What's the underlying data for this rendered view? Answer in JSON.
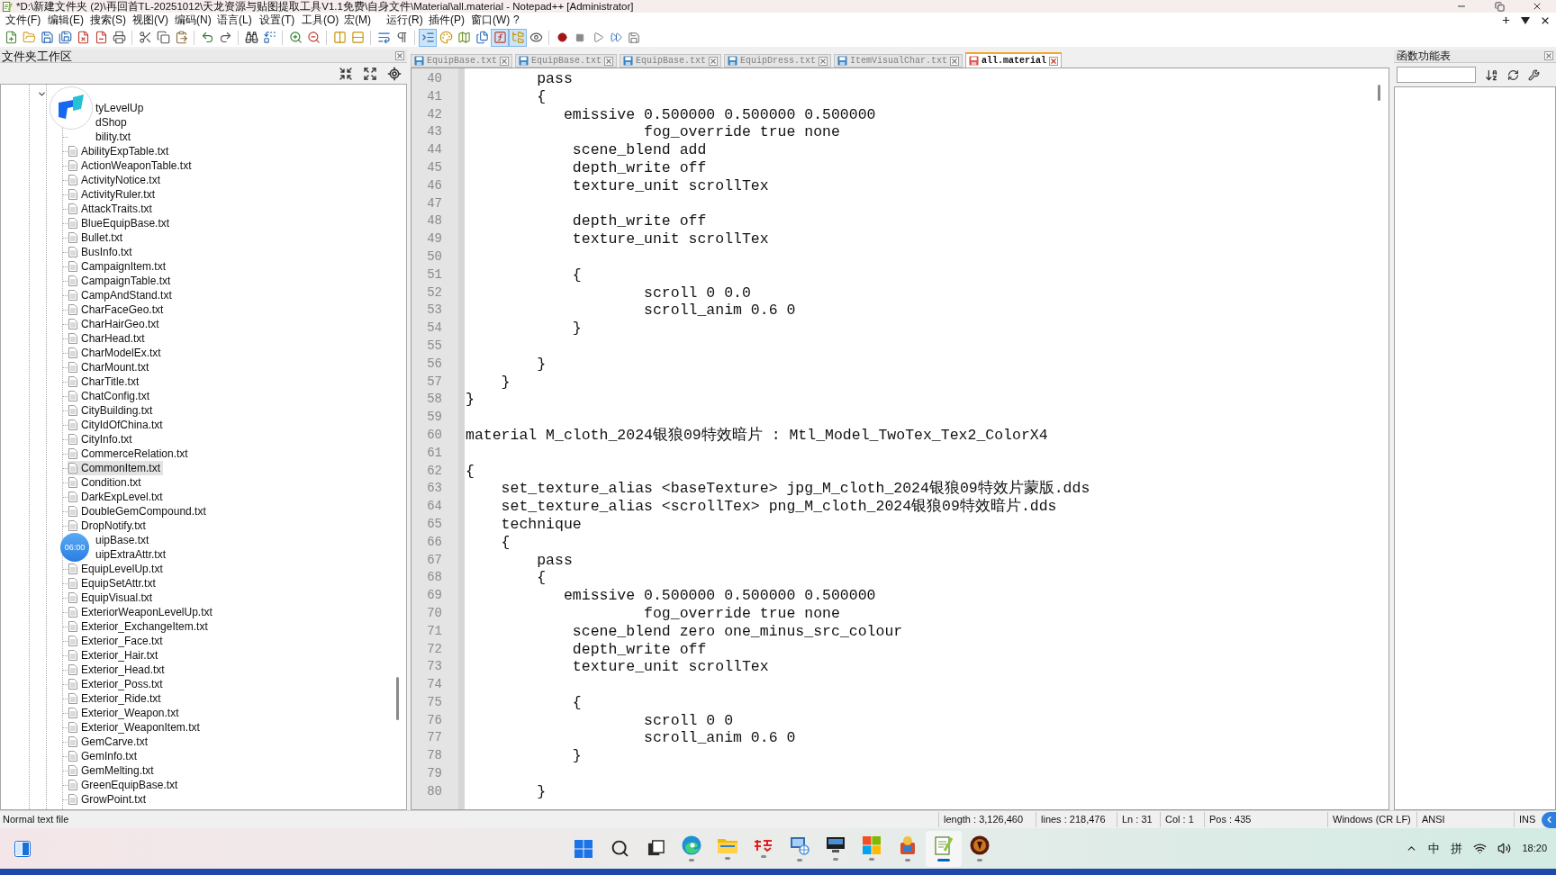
{
  "window": {
    "title": "*D:\\新建文件夹 (2)\\再回首TL-20251012\\天龙资源与贴图提取工具V1.1免费\\自身文件\\Material\\all.material - Notepad++ [Administrator]"
  },
  "menu": [
    "文件(F)",
    "编辑(E)",
    "搜索(S)",
    "视图(V)",
    "编码(N)",
    "语言(L)",
    "设置(T)",
    "工具(O)",
    "宏(M)",
    "运行(R)",
    "插件(P)",
    "窗口(W)",
    "?"
  ],
  "toolbar": [
    {
      "pressed": false
    },
    {
      "pressed": false
    },
    {
      "pressed": false
    },
    {
      "pressed": false
    },
    {
      "pressed": false
    },
    {
      "pressed": false
    },
    {
      "pressed": false
    },
    {
      "pressed": false
    },
    {
      "pressed": false
    },
    {
      "pressed": false
    },
    {
      "pressed": false
    },
    {
      "pressed": false
    },
    {
      "pressed": false
    },
    {
      "pressed": false
    },
    {
      "pressed": false
    },
    {
      "pressed": false
    },
    {
      "pressed": false
    },
    {
      "pressed": false
    },
    {
      "pressed": false
    },
    {
      "pressed": false
    },
    {
      "pressed": true
    },
    {
      "pressed": false
    },
    {
      "pressed": false
    },
    {
      "pressed": false
    },
    {
      "pressed": true
    },
    {
      "pressed": true
    },
    {
      "pressed": false
    },
    {
      "pressed": false
    },
    {
      "pressed": false
    },
    {
      "pressed": false
    },
    {
      "pressed": false
    },
    {
      "pressed": false
    }
  ],
  "folder_panel": {
    "title": "文件夹工作区",
    "tree": {
      "expanded": true,
      "children": [
        {
          "name": "tyLevelUp",
          "kind": "partial",
          "selected": false
        },
        {
          "name": "dShop",
          "kind": "partial",
          "selected": false
        },
        {
          "name": "bility.txt",
          "kind": "partial",
          "selected": false
        },
        {
          "name": "AbilityExpTable.txt",
          "kind": "file",
          "selected": false
        },
        {
          "name": "ActionWeaponTable.txt",
          "kind": "file",
          "selected": false
        },
        {
          "name": "ActivityNotice.txt",
          "kind": "file",
          "selected": false
        },
        {
          "name": "ActivityRuler.txt",
          "kind": "file",
          "selected": false
        },
        {
          "name": "AttackTraits.txt",
          "kind": "file",
          "selected": false
        },
        {
          "name": "BlueEquipBase.txt",
          "kind": "file",
          "selected": false
        },
        {
          "name": "Bullet.txt",
          "kind": "file",
          "selected": false
        },
        {
          "name": "BusInfo.txt",
          "kind": "file",
          "selected": false
        },
        {
          "name": "CampaignItem.txt",
          "kind": "file",
          "selected": false
        },
        {
          "name": "CampaignTable.txt",
          "kind": "file",
          "selected": false
        },
        {
          "name": "CampAndStand.txt",
          "kind": "file",
          "selected": false
        },
        {
          "name": "CharFaceGeo.txt",
          "kind": "file",
          "selected": false
        },
        {
          "name": "CharHairGeo.txt",
          "kind": "file",
          "selected": false
        },
        {
          "name": "CharHead.txt",
          "kind": "file",
          "selected": false
        },
        {
          "name": "CharModelEx.txt",
          "kind": "file",
          "selected": false
        },
        {
          "name": "CharMount.txt",
          "kind": "file",
          "selected": false
        },
        {
          "name": "CharTitle.txt",
          "kind": "file",
          "selected": false
        },
        {
          "name": "ChatConfig.txt",
          "kind": "file",
          "selected": false
        },
        {
          "name": "CityBuilding.txt",
          "kind": "file",
          "selected": false
        },
        {
          "name": "CityIdOfChina.txt",
          "kind": "file",
          "selected": false
        },
        {
          "name": "CityInfo.txt",
          "kind": "file",
          "selected": false
        },
        {
          "name": "CommerceRelation.txt",
          "kind": "file",
          "selected": false
        },
        {
          "name": "CommonItem.txt",
          "kind": "file",
          "selected": true
        },
        {
          "name": "Condition.txt",
          "kind": "file",
          "selected": false
        },
        {
          "name": "DarkExpLevel.txt",
          "kind": "file",
          "selected": false
        },
        {
          "name": "DoubleGemCompound.txt",
          "kind": "file",
          "selected": false
        },
        {
          "name": "DropNotify.txt",
          "kind": "file",
          "selected": false
        },
        {
          "name": "uipBase.txt",
          "kind": "partial",
          "selected": false
        },
        {
          "name": "uipExtraAttr.txt",
          "kind": "partial",
          "selected": false
        },
        {
          "name": "EquipLevelUp.txt",
          "kind": "file",
          "selected": false
        },
        {
          "name": "EquipSetAttr.txt",
          "kind": "file",
          "selected": false
        },
        {
          "name": "EquipVisual.txt",
          "kind": "file",
          "selected": false
        },
        {
          "name": "ExteriorWeaponLevelUp.txt",
          "kind": "file",
          "selected": false
        },
        {
          "name": "Exterior_ExchangeItem.txt",
          "kind": "file",
          "selected": false
        },
        {
          "name": "Exterior_Face.txt",
          "kind": "file",
          "selected": false
        },
        {
          "name": "Exterior_Hair.txt",
          "kind": "file",
          "selected": false
        },
        {
          "name": "Exterior_Head.txt",
          "kind": "file",
          "selected": false
        },
        {
          "name": "Exterior_Poss.txt",
          "kind": "file",
          "selected": false
        },
        {
          "name": "Exterior_Ride.txt",
          "kind": "file",
          "selected": false
        },
        {
          "name": "Exterior_Weapon.txt",
          "kind": "file",
          "selected": false
        },
        {
          "name": "Exterior_WeaponItem.txt",
          "kind": "file",
          "selected": false
        },
        {
          "name": "GemCarve.txt",
          "kind": "file",
          "selected": false
        },
        {
          "name": "GemInfo.txt",
          "kind": "file",
          "selected": false
        },
        {
          "name": "GemMelting.txt",
          "kind": "file",
          "selected": false
        },
        {
          "name": "GreenEquipBase.txt",
          "kind": "file",
          "selected": false
        },
        {
          "name": "GrowPoint.txt",
          "kind": "file",
          "selected": false
        }
      ]
    }
  },
  "recording_timer": "06:00",
  "tabs": [
    {
      "label": "EquipBase.txt",
      "selected": false,
      "modified": false
    },
    {
      "label": "EquipBase.txt",
      "selected": false,
      "modified": false
    },
    {
      "label": "EquipBase.txt",
      "selected": false,
      "modified": false
    },
    {
      "label": "EquipDress.txt",
      "selected": false,
      "modified": false
    },
    {
      "label": "ItemVisualChar.txt",
      "selected": false,
      "modified": false
    },
    {
      "label": "all.material",
      "selected": true,
      "modified": true
    }
  ],
  "editor": {
    "lines": [
      {
        "number": "40",
        "text": "        pass"
      },
      {
        "number": "41",
        "text": "        {"
      },
      {
        "number": "42",
        "text": "           emissive 0.500000 0.500000 0.500000"
      },
      {
        "number": "43",
        "text": "                    fog_override true none"
      },
      {
        "number": "44",
        "text": "            scene_blend add"
      },
      {
        "number": "45",
        "text": "            depth_write off"
      },
      {
        "number": "46",
        "text": "            texture_unit scrollTex"
      },
      {
        "number": "47"
      },
      {
        "number": "48",
        "text": "            depth_write off"
      },
      {
        "number": "49",
        "text": "            texture_unit scrollTex"
      },
      {
        "number": "50"
      },
      {
        "number": "51",
        "text": "            {"
      },
      {
        "number": "52",
        "text": "                    scroll 0 0.0"
      },
      {
        "number": "53",
        "text": "                    scroll_anim 0.6 0"
      },
      {
        "number": "54",
        "text": "            }"
      },
      {
        "number": "55"
      },
      {
        "number": "56",
        "text": "        }"
      },
      {
        "number": "57",
        "text": "    }"
      },
      {
        "number": "58",
        "text": "}"
      },
      {
        "number": "59"
      },
      {
        "number": "60",
        "text": "material M_cloth_2024银狼09特效暗片 : Mtl_Model_TwoTex_Tex2_ColorX4"
      },
      {
        "number": "61"
      },
      {
        "number": "62",
        "text": "{"
      },
      {
        "number": "63",
        "text": "    set_texture_alias <baseTexture> jpg_M_cloth_2024银狼09特效片蒙版.dds"
      },
      {
        "number": "64",
        "text": "    set_texture_alias <scrollTex> png_M_cloth_2024银狼09特效暗片.dds"
      },
      {
        "number": "65",
        "text": "    technique"
      },
      {
        "number": "66",
        "text": "    {"
      },
      {
        "number": "67",
        "text": "        pass"
      },
      {
        "number": "68",
        "text": "        {"
      },
      {
        "number": "69",
        "text": "           emissive 0.500000 0.500000 0.500000"
      },
      {
        "number": "70",
        "text": "                    fog_override true none"
      },
      {
        "number": "71",
        "text": "            scene_blend zero one_minus_src_colour"
      },
      {
        "number": "72",
        "text": "            depth_write off"
      },
      {
        "number": "73",
        "text": "            texture_unit scrollTex"
      },
      {
        "number": "74"
      },
      {
        "number": "75",
        "text": "            {"
      },
      {
        "number": "76",
        "text": "                    scroll 0 0"
      },
      {
        "number": "77",
        "text": "                    scroll_anim 0.6 0"
      },
      {
        "number": "78",
        "text": "            }"
      },
      {
        "number": "79"
      },
      {
        "number": "80",
        "text": "        }"
      }
    ]
  },
  "function_panel": {
    "title": "函数功能表"
  },
  "status_bar": {
    "file_type": "Normal text file",
    "fields": [
      "length : 3,126,460",
      "lines : 218,476",
      "Ln : 31",
      "Col : 1",
      "Pos : 435",
      "Windows (CR LF)",
      "ANSI",
      "INS"
    ]
  },
  "taskbar": {
    "buttons": [
      {
        "running": false,
        "active": false
      },
      {
        "running": false,
        "active": false
      },
      {
        "running": false,
        "active": false
      },
      {
        "running": true,
        "active": false
      },
      {
        "running": true,
        "active": false
      },
      {
        "running": true,
        "active": false
      },
      {
        "running": true,
        "active": false
      },
      {
        "running": true,
        "active": false
      },
      {
        "running": true,
        "active": false
      },
      {
        "running": true,
        "active": false
      },
      {
        "running": true,
        "active": true
      },
      {
        "running": true,
        "active": false
      }
    ],
    "tray": {
      "ime": "中",
      "input_mode": "拼",
      "time": "18:20"
    }
  }
}
